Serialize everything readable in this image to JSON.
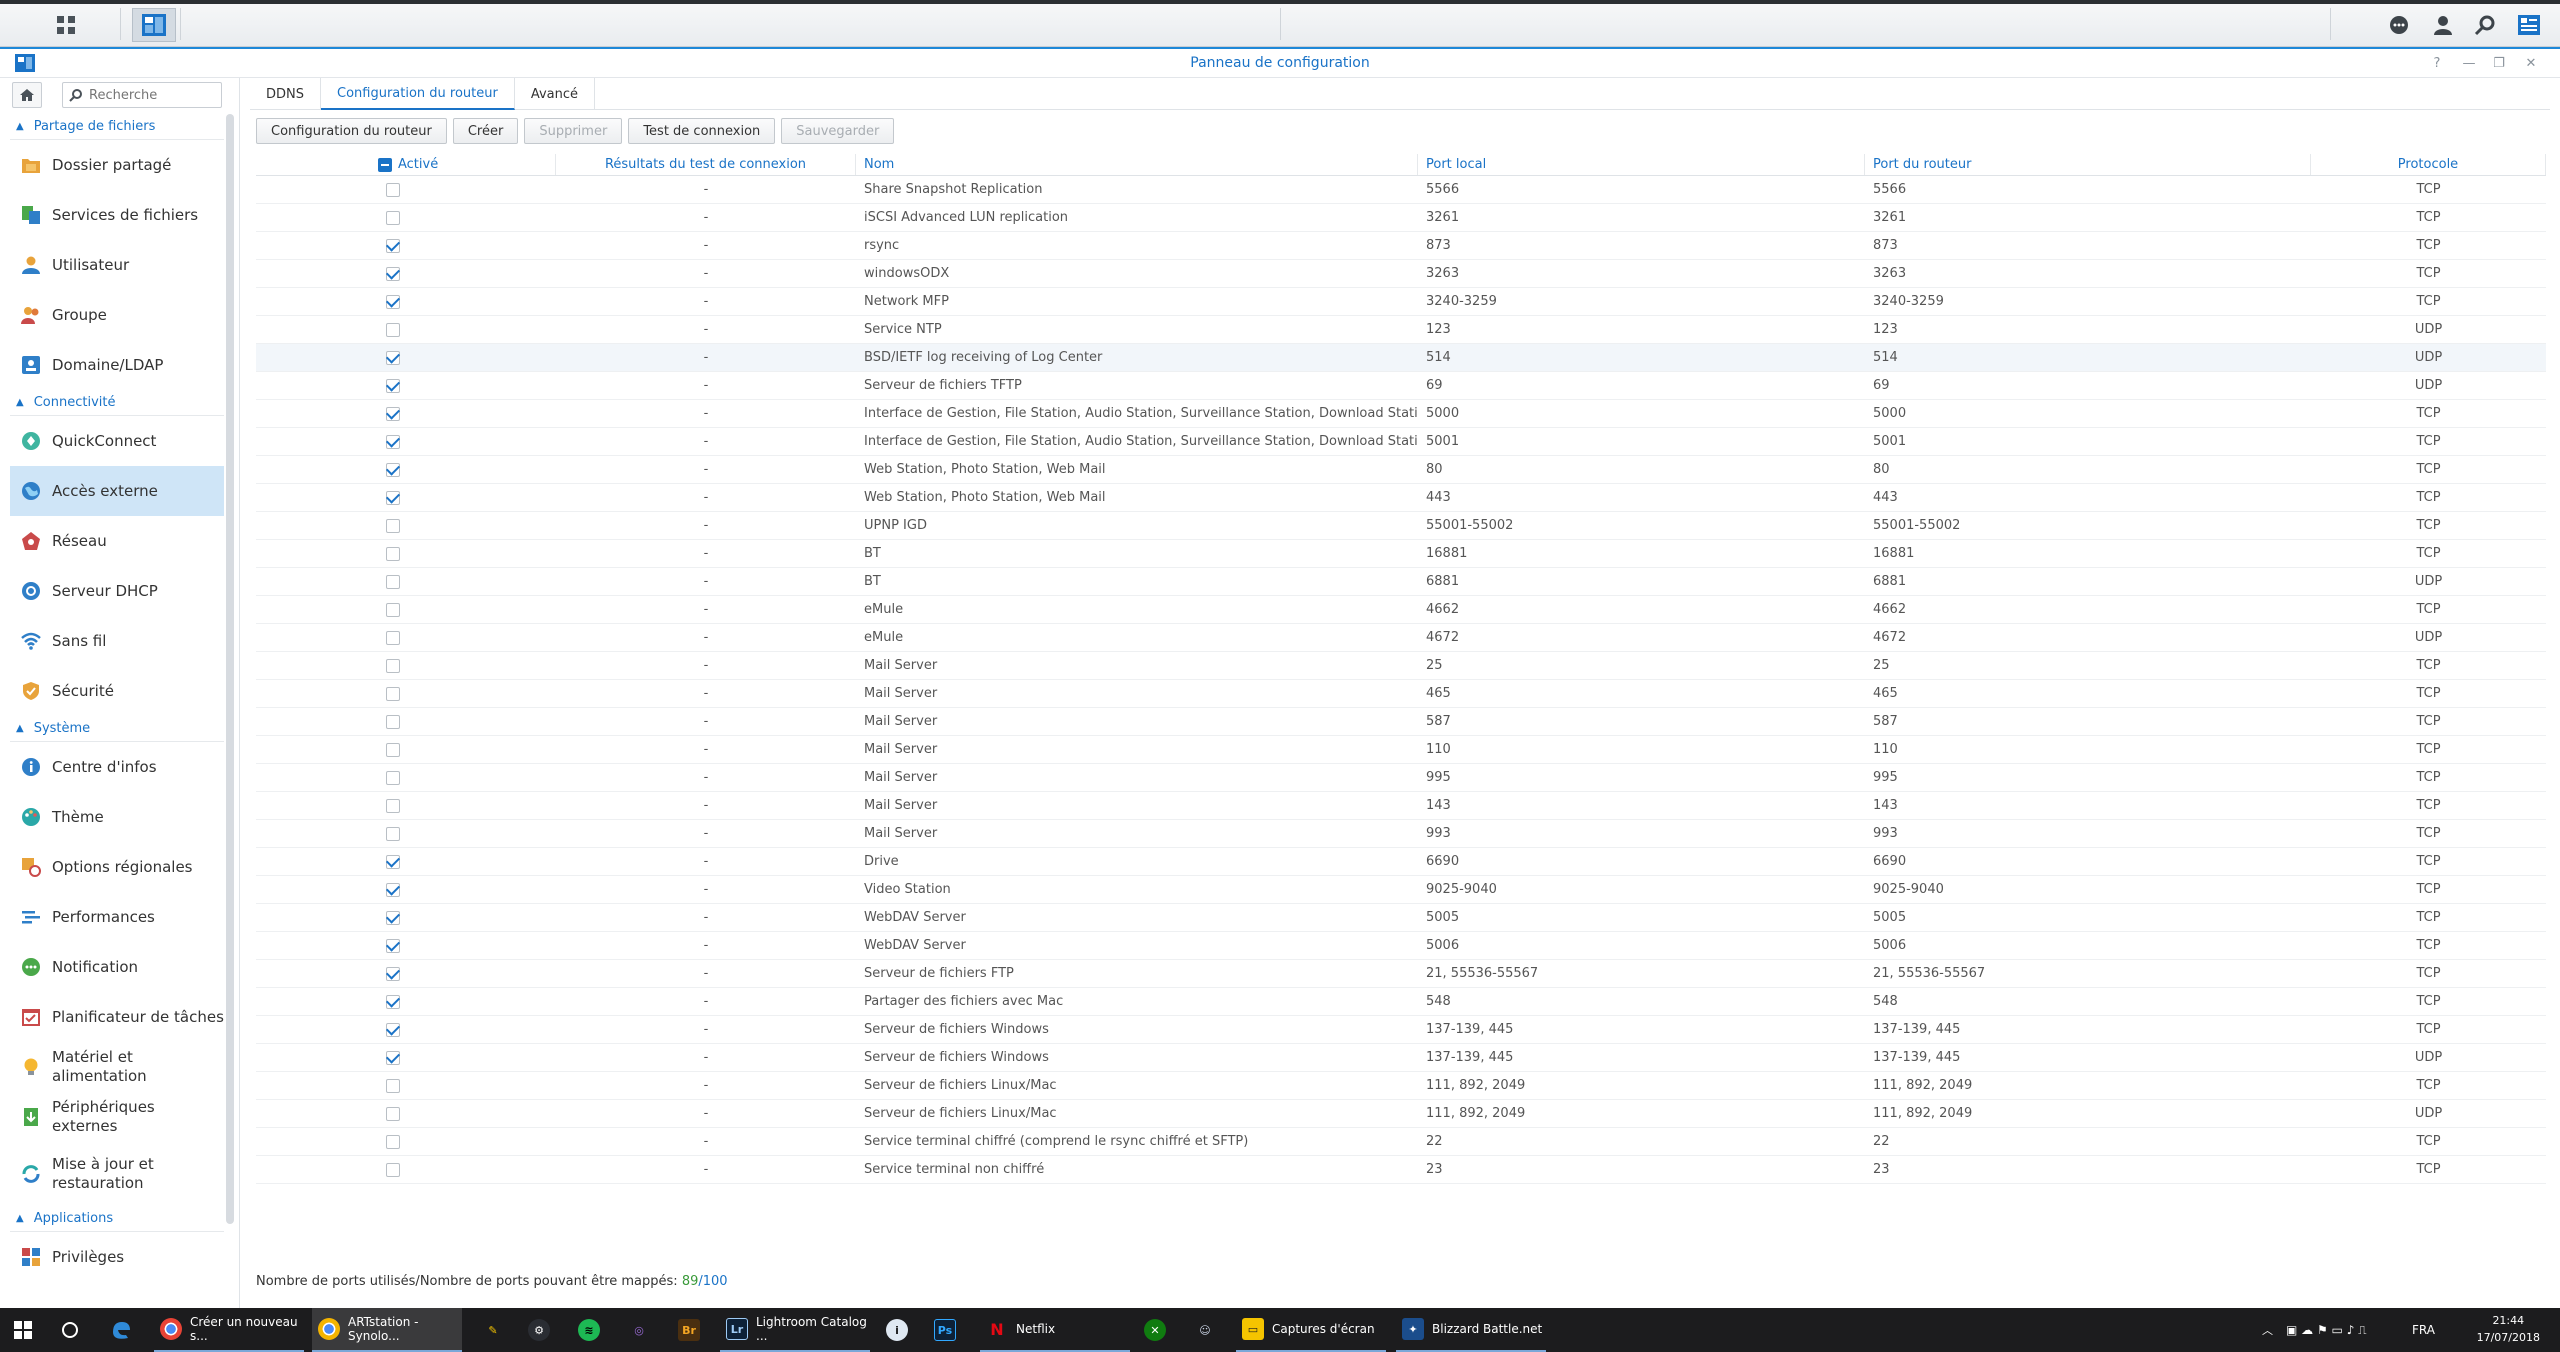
{
  "window": {
    "title": "Panneau de configuration"
  },
  "sidebar": {
    "search_placeholder": "Recherche",
    "sections": [
      {
        "label": "Partage de fichiers",
        "items": [
          "Dossier partagé",
          "Services de fichiers",
          "Utilisateur",
          "Groupe",
          "Domaine/LDAP"
        ]
      },
      {
        "label": "Connectivité",
        "items": [
          "QuickConnect",
          "Accès externe",
          "Réseau",
          "Serveur DHCP",
          "Sans fil",
          "Sécurité"
        ]
      },
      {
        "label": "Système",
        "items": [
          "Centre d'infos",
          "Thème",
          "Options régionales",
          "Performances",
          "Notification",
          "Planificateur de tâches",
          "Matériel et alimentation",
          "Périphériques externes",
          "Mise à jour et restauration"
        ]
      },
      {
        "label": "Applications",
        "items": [
          "Privilèges"
        ]
      }
    ],
    "active_item": "Accès externe"
  },
  "tabs": [
    "DDNS",
    "Configuration du routeur",
    "Avancé"
  ],
  "active_tab": "Configuration du routeur",
  "toolbar": {
    "config": "Configuration du routeur",
    "create": "Créer",
    "delete": "Supprimer",
    "test": "Test de connexion",
    "save": "Sauvegarder"
  },
  "table": {
    "headers": {
      "active": "Activé",
      "result": "Résultats du test de connexion",
      "name": "Nom",
      "local": "Port local",
      "router": "Port du routeur",
      "protocol": "Protocole"
    },
    "rows": [
      {
        "on": false,
        "res": "-",
        "name": "Share Snapshot Replication",
        "local": "5566",
        "router": "5566",
        "proto": "TCP"
      },
      {
        "on": false,
        "res": "-",
        "name": "iSCSI Advanced LUN replication",
        "local": "3261",
        "router": "3261",
        "proto": "TCP"
      },
      {
        "on": true,
        "res": "-",
        "name": "rsync",
        "local": "873",
        "router": "873",
        "proto": "TCP"
      },
      {
        "on": true,
        "res": "-",
        "name": "windowsODX",
        "local": "3263",
        "router": "3263",
        "proto": "TCP"
      },
      {
        "on": true,
        "res": "-",
        "name": "Network MFP",
        "local": "3240-3259",
        "router": "3240-3259",
        "proto": "TCP"
      },
      {
        "on": false,
        "res": "-",
        "name": "Service NTP",
        "local": "123",
        "router": "123",
        "proto": "UDP"
      },
      {
        "on": true,
        "res": "-",
        "name": "BSD/IETF log receiving of Log Center",
        "local": "514",
        "router": "514",
        "proto": "UDP"
      },
      {
        "on": true,
        "res": "-",
        "name": "Serveur de fichiers TFTP",
        "local": "69",
        "router": "69",
        "proto": "UDP"
      },
      {
        "on": true,
        "res": "-",
        "name": "Interface de Gestion, File Station, Audio Station, Surveillance Station, Download Statio...",
        "local": "5000",
        "router": "5000",
        "proto": "TCP"
      },
      {
        "on": true,
        "res": "-",
        "name": "Interface de Gestion, File Station, Audio Station, Surveillance Station, Download Statio...",
        "local": "5001",
        "router": "5001",
        "proto": "TCP"
      },
      {
        "on": true,
        "res": "-",
        "name": "Web Station, Photo Station, Web Mail",
        "local": "80",
        "router": "80",
        "proto": "TCP"
      },
      {
        "on": true,
        "res": "-",
        "name": "Web Station, Photo Station, Web Mail",
        "local": "443",
        "router": "443",
        "proto": "TCP"
      },
      {
        "on": false,
        "res": "-",
        "name": "UPNP IGD",
        "local": "55001-55002",
        "router": "55001-55002",
        "proto": "TCP"
      },
      {
        "on": false,
        "res": "-",
        "name": "BT",
        "local": "16881",
        "router": "16881",
        "proto": "TCP"
      },
      {
        "on": false,
        "res": "-",
        "name": "BT",
        "local": "6881",
        "router": "6881",
        "proto": "UDP"
      },
      {
        "on": false,
        "res": "-",
        "name": "eMule",
        "local": "4662",
        "router": "4662",
        "proto": "TCP"
      },
      {
        "on": false,
        "res": "-",
        "name": "eMule",
        "local": "4672",
        "router": "4672",
        "proto": "UDP"
      },
      {
        "on": false,
        "res": "-",
        "name": "Mail Server",
        "local": "25",
        "router": "25",
        "proto": "TCP"
      },
      {
        "on": false,
        "res": "-",
        "name": "Mail Server",
        "local": "465",
        "router": "465",
        "proto": "TCP"
      },
      {
        "on": false,
        "res": "-",
        "name": "Mail Server",
        "local": "587",
        "router": "587",
        "proto": "TCP"
      },
      {
        "on": false,
        "res": "-",
        "name": "Mail Server",
        "local": "110",
        "router": "110",
        "proto": "TCP"
      },
      {
        "on": false,
        "res": "-",
        "name": "Mail Server",
        "local": "995",
        "router": "995",
        "proto": "TCP"
      },
      {
        "on": false,
        "res": "-",
        "name": "Mail Server",
        "local": "143",
        "router": "143",
        "proto": "TCP"
      },
      {
        "on": false,
        "res": "-",
        "name": "Mail Server",
        "local": "993",
        "router": "993",
        "proto": "TCP"
      },
      {
        "on": true,
        "res": "-",
        "name": "Drive",
        "local": "6690",
        "router": "6690",
        "proto": "TCP"
      },
      {
        "on": true,
        "res": "-",
        "name": "Video Station",
        "local": "9025-9040",
        "router": "9025-9040",
        "proto": "TCP"
      },
      {
        "on": true,
        "res": "-",
        "name": "WebDAV Server",
        "local": "5005",
        "router": "5005",
        "proto": "TCP"
      },
      {
        "on": true,
        "res": "-",
        "name": "WebDAV Server",
        "local": "5006",
        "router": "5006",
        "proto": "TCP"
      },
      {
        "on": true,
        "res": "-",
        "name": "Serveur de fichiers FTP",
        "local": "21, 55536-55567",
        "router": "21, 55536-55567",
        "proto": "TCP"
      },
      {
        "on": true,
        "res": "-",
        "name": "Partager des fichiers avec Mac",
        "local": "548",
        "router": "548",
        "proto": "TCP"
      },
      {
        "on": true,
        "res": "-",
        "name": "Serveur de fichiers Windows",
        "local": "137-139, 445",
        "router": "137-139, 445",
        "proto": "TCP"
      },
      {
        "on": true,
        "res": "-",
        "name": "Serveur de fichiers Windows",
        "local": "137-139, 445",
        "router": "137-139, 445",
        "proto": "UDP"
      },
      {
        "on": false,
        "res": "-",
        "name": "Serveur de fichiers Linux/Mac",
        "local": "111, 892, 2049",
        "router": "111, 892, 2049",
        "proto": "TCP"
      },
      {
        "on": false,
        "res": "-",
        "name": "Serveur de fichiers Linux/Mac",
        "local": "111, 892, 2049",
        "router": "111, 892, 2049",
        "proto": "UDP"
      },
      {
        "on": false,
        "res": "-",
        "name": "Service terminal chiffré (comprend le rsync chiffré et SFTP)",
        "local": "22",
        "router": "22",
        "proto": "TCP"
      },
      {
        "on": false,
        "res": "-",
        "name": "Service terminal non chiffré",
        "local": "23",
        "router": "23",
        "proto": "TCP"
      }
    ]
  },
  "footer": {
    "label": "Nombre de ports utilisés/Nombre de ports pouvant être mappés:",
    "used": "89",
    "slash": "/",
    "max": "100"
  },
  "taskbar": {
    "apps": [
      {
        "label": "Créer un nouveau s..."
      },
      {
        "label": "ARTstation - Synolo..."
      },
      {
        "label": "Lightroom Catalog ..."
      },
      {
        "label": "Netflix"
      },
      {
        "label": "Captures d'écran"
      },
      {
        "label": "Blizzard Battle.net"
      }
    ],
    "lang": "FRA",
    "time": "21:44",
    "date": "17/07/2018"
  },
  "colors": {
    "accent": "#1a73c7",
    "used_count": "#3a9a3a"
  }
}
